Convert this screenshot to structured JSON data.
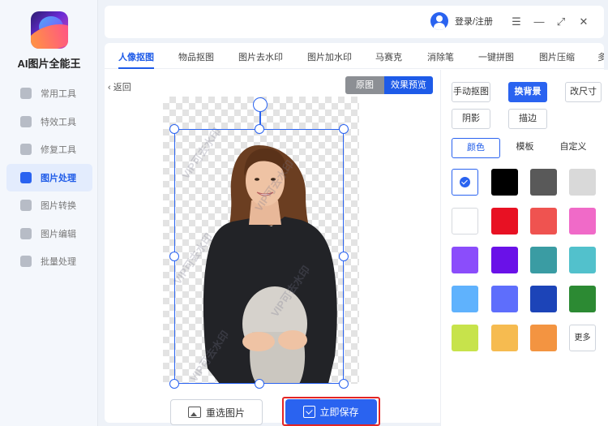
{
  "app": {
    "name": "AI图片全能王"
  },
  "sidebar": {
    "items": [
      {
        "label": "常用工具",
        "icon": "grid-icon",
        "active": false
      },
      {
        "label": "特效工具",
        "icon": "star-icon",
        "active": false
      },
      {
        "label": "修复工具",
        "icon": "bandage-icon",
        "active": false
      },
      {
        "label": "图片处理",
        "icon": "image-process-icon",
        "active": true
      },
      {
        "label": "图片转换",
        "icon": "convert-icon",
        "active": false
      },
      {
        "label": "图片编辑",
        "icon": "edit-icon",
        "active": false
      },
      {
        "label": "批量处理",
        "icon": "batch-icon",
        "active": false
      }
    ]
  },
  "topbar": {
    "login_label": "登录/注册",
    "controls": [
      "☰",
      "—",
      "⤢",
      "✕"
    ]
  },
  "tabs": [
    "人像抠图",
    "物品抠图",
    "图片去水印",
    "图片加水印",
    "马赛克",
    "消除笔",
    "一键拼图",
    "图片压缩",
    "多"
  ],
  "active_tab": "人像抠图",
  "editor": {
    "back_label": "返回",
    "toggle": {
      "original": "原图",
      "preview": "效果预览"
    },
    "watermark_text": "VIP可去水印",
    "reselect_label": "重选图片",
    "save_label": "立即保存"
  },
  "right_panel": {
    "options": [
      "手动抠图",
      "换背景",
      "改尺寸",
      "阴影",
      "描边"
    ],
    "active_option": "换背景",
    "subtabs": [
      "颜色",
      "模板",
      "自定义"
    ],
    "active_subtab": "颜色",
    "colors": [
      "transparent-selected",
      "#000000",
      "#595959",
      "#d9d9d9",
      "#ffffff",
      "#e81123",
      "#ef5350",
      "#f06ac8",
      "#8b4dfb",
      "#6a11e8",
      "#3a9ca3",
      "#52c1cc",
      "#5fb2fd",
      "#5e6efc",
      "#1c44b8",
      "#2c8a33",
      "#c7e34b",
      "#f6bb50",
      "#f39441"
    ],
    "more_label": "更多"
  }
}
